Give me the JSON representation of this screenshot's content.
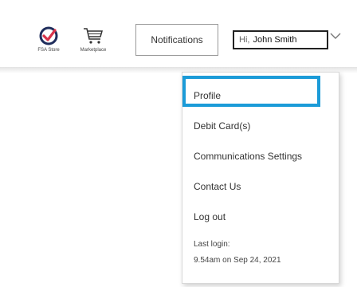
{
  "header": {
    "fsa_store_label": "FSA Store",
    "marketplace_label": "Marketplace",
    "notifications_label": "Notifications",
    "user_greeting": "Hi,",
    "user_name": "John Smith"
  },
  "menu": {
    "items": [
      "Profile",
      "Debit Card(s)",
      "Communications Settings",
      "Contact Us",
      "Log out"
    ],
    "last_login_label": "Last login:",
    "last_login_value": "9.54am on Sep 24, 2021"
  },
  "colors": {
    "focus_ring": "#1b9bd8",
    "fsa_check_red": "#d8334a",
    "fsa_check_navy": "#1f2d5c"
  }
}
